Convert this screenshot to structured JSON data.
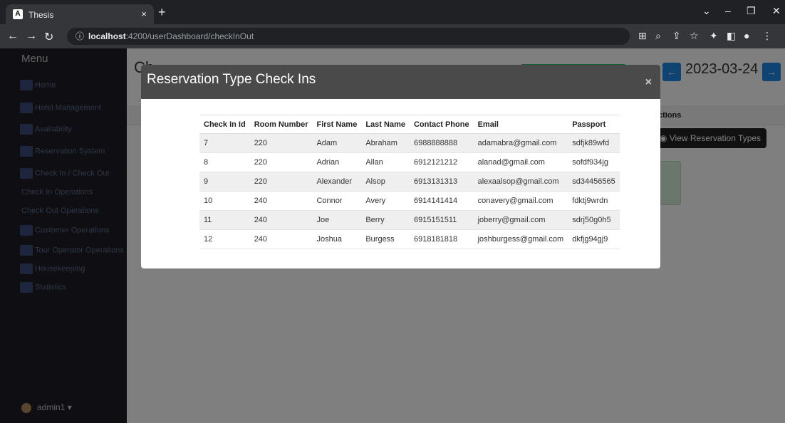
{
  "browser": {
    "tab_title": "Thesis",
    "tab_favicon": "A",
    "close_tab": "×",
    "new_tab": "+",
    "url_host": "localhost",
    "url_path": ":4200/userDashboard/checkInOut"
  },
  "sidebar": {
    "title": "Menu",
    "items": [
      {
        "label": "Home",
        "icon": "home-icon"
      },
      {
        "label": "Hotel Management",
        "icon": "dashboard-icon"
      },
      {
        "label": "Availability",
        "icon": "grid-icon"
      },
      {
        "label": "Reservation System",
        "icon": "calendar-icon"
      },
      {
        "label": "Check In / Check Out",
        "icon": "building-icon"
      },
      {
        "label": "Check In Operations"
      },
      {
        "label": "Check Out Operations"
      },
      {
        "label": "Customer Operations",
        "icon": "users-icon"
      },
      {
        "label": "Tour Operator Operations",
        "icon": "plane-icon"
      },
      {
        "label": "Housekeeping",
        "icon": "broom-icon"
      },
      {
        "label": "Statistics",
        "icon": "chart-icon"
      }
    ],
    "user": "admin1"
  },
  "main": {
    "title": "Ch",
    "date": "2023-03-24",
    "prev": "←",
    "next": "→",
    "actions_header": "ctions",
    "view_button": "View Reservation Types"
  },
  "modal": {
    "title": "Reservation Type Check Ins",
    "close": "×",
    "columns": [
      "Check In Id",
      "Room Number",
      "First Name",
      "Last Name",
      "Contact Phone",
      "Email",
      "Passport"
    ],
    "rows": [
      [
        "7",
        "220",
        "Adam",
        "Abraham",
        "6988888888",
        "adamabra@gmail.com",
        "sdfjk89wfd"
      ],
      [
        "8",
        "220",
        "Adrian",
        "Allan",
        "6912121212",
        "alanad@gmail.com",
        "sofdf934jg"
      ],
      [
        "9",
        "220",
        "Alexander",
        "Alsop",
        "6913131313",
        "alexaalsop@gmail.com",
        "sd34456565"
      ],
      [
        "10",
        "240",
        "Connor",
        "Avery",
        "6914141414",
        "conavery@gmail.com",
        "fdktj9wrdn"
      ],
      [
        "11",
        "240",
        "Joe",
        "Berry",
        "6915151511",
        "joberry@gmail.com",
        "sdrj50g0h5"
      ],
      [
        "12",
        "240",
        "Joshua",
        "Burgess",
        "6918181818",
        "joshburgess@gmail.com",
        "dkfjg94gj9"
      ]
    ]
  }
}
